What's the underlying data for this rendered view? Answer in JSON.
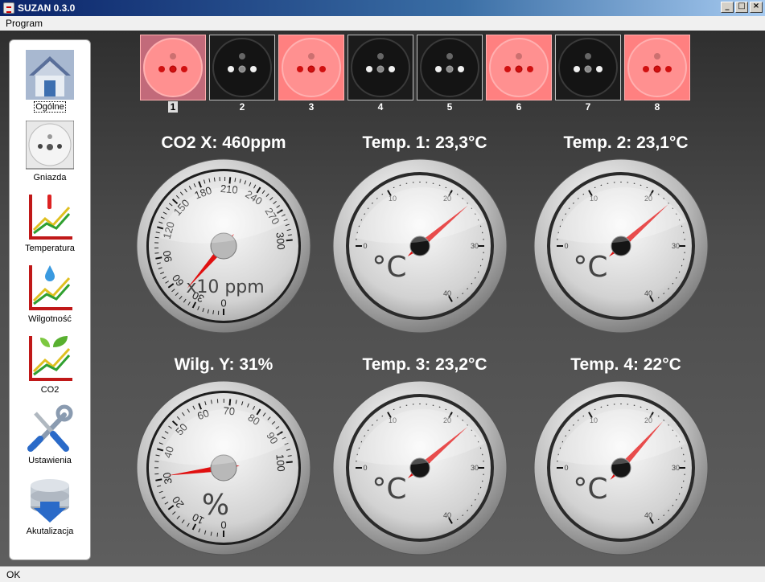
{
  "window": {
    "title": "SUZAN 0.3.0",
    "min": "_",
    "max": "□",
    "close": "×"
  },
  "menu": {
    "program": "Program"
  },
  "sidebar": {
    "items": [
      {
        "label": "Ogólne",
        "icon": "house-icon",
        "selected": true
      },
      {
        "label": "Gniazda",
        "icon": "socket-icon"
      },
      {
        "label": "Temperatura",
        "icon": "temperature-chart-icon"
      },
      {
        "label": "Wilgotność",
        "icon": "humidity-chart-icon"
      },
      {
        "label": "CO2",
        "icon": "co2-chart-icon"
      },
      {
        "label": "Ustawienia",
        "icon": "tools-icon"
      },
      {
        "label": "Akutalizacja",
        "icon": "update-database-icon"
      }
    ]
  },
  "sockets": [
    {
      "number": "1",
      "on": true,
      "active": true
    },
    {
      "number": "2",
      "on": false
    },
    {
      "number": "3",
      "on": true
    },
    {
      "number": "4",
      "on": false
    },
    {
      "number": "5",
      "on": false
    },
    {
      "number": "6",
      "on": true
    },
    {
      "number": "7",
      "on": false
    },
    {
      "number": "8",
      "on": true
    }
  ],
  "gauges": [
    {
      "title": "CO2 X: 460ppm",
      "type": "co2",
      "unit": "x10 ppm",
      "min": 0,
      "max": 300,
      "ticks": [
        0,
        30,
        60,
        90,
        120,
        150,
        180,
        210,
        240,
        270,
        300
      ],
      "value": 46
    },
    {
      "title": "Temp. 1: 23,3°C",
      "type": "temp",
      "unit": "°C",
      "min": 0,
      "max": 40,
      "ticks": [
        0,
        10,
        20,
        30,
        40
      ],
      "value": 23.3
    },
    {
      "title": "Temp. 2: 23,1°C",
      "type": "temp",
      "unit": "°C",
      "min": 0,
      "max": 40,
      "ticks": [
        0,
        10,
        20,
        30,
        40
      ],
      "value": 23.1
    },
    {
      "title": "Wilg. Y: 31%",
      "type": "hum",
      "unit": "%",
      "min": 0,
      "max": 100,
      "ticks": [
        0,
        10,
        20,
        30,
        40,
        50,
        60,
        70,
        80,
        90,
        100
      ],
      "value": 31
    },
    {
      "title": "Temp. 3: 23,2°C",
      "type": "temp",
      "unit": "°C",
      "min": 0,
      "max": 40,
      "ticks": [
        0,
        10,
        20,
        30,
        40
      ],
      "value": 23.2
    },
    {
      "title": "Temp. 4: 22°C",
      "type": "temp",
      "unit": "°C",
      "min": 0,
      "max": 40,
      "ticks": [
        0,
        10,
        20,
        30,
        40
      ],
      "value": 22
    }
  ],
  "status": {
    "text": "OK"
  },
  "colors": {
    "socket_on": "#ff8080",
    "socket_off": "#1b1b1b",
    "needle": "#e01010"
  }
}
